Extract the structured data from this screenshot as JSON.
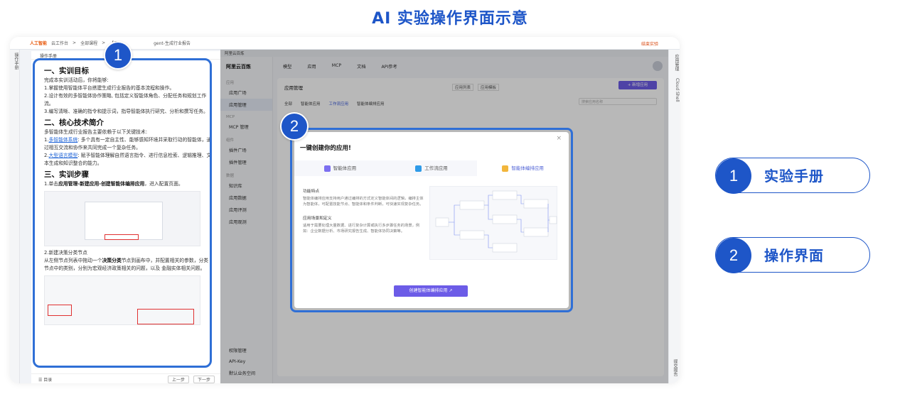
{
  "title": "AI 实验操作界面示意",
  "topbar": {
    "logo": "人工智能",
    "crumbs": [
      "云工作台",
      ">",
      "全部课程",
      ">",
      "【云",
      "gent-生成行业报告"
    ],
    "exit": "结束实验"
  },
  "rails": {
    "left": "操作手册",
    "right_items": [
      "应用管理",
      "Cloud Shell"
    ],
    "right_bottom": "提交报告"
  },
  "manual": {
    "header": "操作手册",
    "sections": [
      {
        "heading": "一、实训目标",
        "lines": [
          "完成本实训活动后，你将能够:",
          "1.掌握使用智能体平台搭建生成行业报告的基本流程和操作。",
          "2.设计有效的多智能体协作策略, 包括定义智能体角色、分配任务和规划工作流。",
          "3.编写清晰、准确的指令和提示词，指导智能体执行研究、分析和撰写任务。"
        ]
      },
      {
        "heading": "二、核心技术简介",
        "lines": [
          "多智能体生成行业报告主要依赖于以下关键技术:"
        ],
        "link1": "多智能体系统",
        "text1": ": 多个具有一定自主性、能够感知环境并采取行动的智能体，通过相互交流和协作来共同完成一个复杂任务。",
        "link2": "大型语言模型",
        "text2": ": 赋予智能体理解自然语言指令、进行信息检索、逻辑推理、文本生成和知识整合的能力。"
      },
      {
        "heading": "三、实训步骤",
        "step1_pre": "1.单击",
        "step1_bold": "应用管理-新建应用-创建智能体编排应用",
        "step1_post": "，进入配置页面。",
        "step2_title": "2.新建决策分类节点",
        "step2_pre": "从左侧节点列表中拖动一个",
        "step2_bold": "决策分类",
        "step2_post": "节点到画布中，并配置相关的参数，分类节点中的类别，分别为宏观经济政策相关的问题，以及 金融实体相关问题。"
      }
    ],
    "footer": {
      "toc": "☰ 目录",
      "prev": "上一步",
      "next": "下一步"
    }
  },
  "app": {
    "tab": "阿里云百炼",
    "brand": "阿里云百炼",
    "side_groups": [
      {
        "group": "应用",
        "items": [
          "应用广场",
          "应用管理"
        ]
      },
      {
        "group": "MCP",
        "items": [
          "MCP 管理"
        ]
      },
      {
        "group": "组件",
        "items": [
          "插件广场",
          "插件管理"
        ]
      },
      {
        "group": "数据",
        "items": [
          "知识库",
          "应用数据",
          "应用评测",
          "应用观测"
        ]
      }
    ],
    "side_footer": [
      "权限管理",
      "API-Key",
      "默认业务空间"
    ],
    "top_nav": [
      "模型",
      "应用",
      "MCP",
      "文档",
      "API参考"
    ],
    "page_title": "应用管理",
    "mini_buttons": [
      "应用列表",
      "应用模板"
    ],
    "add_button": "+ 新增应用",
    "sub_tabs": [
      "全部",
      "智能体应用",
      "工作流应用",
      "智能体编排应用"
    ],
    "search_placeholder": "搜索应用名称"
  },
  "dialog": {
    "title": "一键创建你的应用!",
    "tabs": [
      "智能体应用",
      "工作流应用",
      "智能体编排应用"
    ],
    "feature_heading": "功能特点",
    "feature_text": "智能体编排应用支持用户通过编排的方式定义智能体间的逻辑，编排主体为智能体，可配置技能节点、智能体和条件判断，可快速实现复杂任务。",
    "scene_heading": "应用场景和定义",
    "scene_text": "适用于需要处理大量数据、进行复杂计算或执行多步骤任务的场景，例如：企业数据分析、市场研究报告生成、智能体协同决策等。",
    "cta": "创建智能体编排应用 ↗"
  },
  "badges": [
    "1",
    "2"
  ],
  "legend": [
    {
      "num": "1",
      "label": "实验手册"
    },
    {
      "num": "2",
      "label": "操作界面"
    }
  ]
}
